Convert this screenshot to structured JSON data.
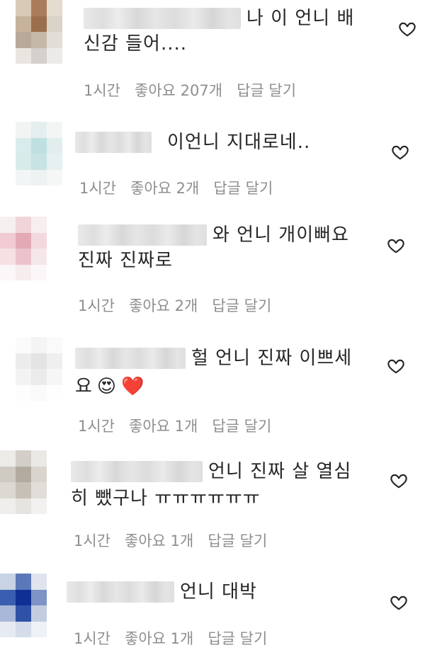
{
  "comments": [
    {
      "text_lines": [
        "나 이 언니 배",
        "신감 들어...."
      ],
      "time": "1시간",
      "likes": "좋아요 207개",
      "reply": "답글 달기",
      "avatar_colors": [
        "#d8cbb6",
        "#a97d5b",
        "#e3dccf",
        "#c7b39b",
        "#9b6f4e",
        "#d9d3c8",
        "#b9a99b",
        "#c6b8a9",
        "#e2ddd7",
        "#e9e6e1",
        "#d4d0cb",
        "#ecebea"
      ]
    },
    {
      "text_lines": [
        "이언니 지대로네.."
      ],
      "time": "1시간",
      "likes": "좋아요 2개",
      "reply": "답글 달기",
      "avatar_colors": [
        "#f2f4f4",
        "#e4eeee",
        "#f3f5f5",
        "#d8ecec",
        "#bfe0e0",
        "#e2eeee",
        "#d7ebea",
        "#c8e3e3",
        "#e6f0f0",
        "#f2f5f5",
        "#edf2f2",
        "#f5f7f7"
      ]
    },
    {
      "text_lines": [
        "와 언니 개이뻐요",
        "진짜 진짜로"
      ],
      "time": "1시간",
      "likes": "좋아요 2개",
      "reply": "답글 달기",
      "avatar_colors": [
        "#f6f0f1",
        "#f0d4d9",
        "#f7eef0",
        "#f1cbd2",
        "#e3aab5",
        "#f3d9de",
        "#f6e0e4",
        "#ecc3cc",
        "#f5e6ea",
        "#fbf6f7",
        "#f7ecee",
        "#fbf7f8"
      ]
    },
    {
      "text_lines": [
        "헐 언니 진짜 이쁘세",
        "요"
      ],
      "emojis": [
        "😍",
        "❤️"
      ],
      "time": "1시간",
      "likes": "좋아요 1개",
      "reply": "답글 달기",
      "avatar_colors": [
        "#fbfbfb",
        "#f4f4f4",
        "#fafafa",
        "#ececec",
        "#e4e4e4",
        "#efefef",
        "#f3f3f3",
        "#ebebeb",
        "#f6f6f6",
        "#fdfdfd",
        "#fafafa",
        "#fefefe"
      ]
    },
    {
      "text_lines": [
        "언니 진짜 살 열심",
        "히 뺐구나 ㅠㅠㅠㅠㅠㅠ"
      ],
      "time": "1시간",
      "likes": "좋아요 1개",
      "reply": "답글 달기",
      "avatar_colors": [
        "#ecebe8",
        "#d3cfc8",
        "#ebe9e6",
        "#cfcac2",
        "#b3ab9f",
        "#d9d5ce",
        "#dcd8d2",
        "#c6c0b6",
        "#e1ded9",
        "#efeeec",
        "#e6e4e1",
        "#f2f1ef"
      ]
    },
    {
      "text_lines": [
        "언니 대박"
      ],
      "time": "1시간",
      "likes": "좋아요 1개",
      "reply": "답글 달기",
      "avatar_colors": [
        "#c9d3e6",
        "#5b79b9",
        "#dfe4ee",
        "#3a5fb0",
        "#0f2f94",
        "#7e93c6",
        "#a9b8d8",
        "#2f52a6",
        "#c3cde2",
        "#e6eaf2",
        "#d4dbe9",
        "#eef1f6"
      ]
    }
  ]
}
